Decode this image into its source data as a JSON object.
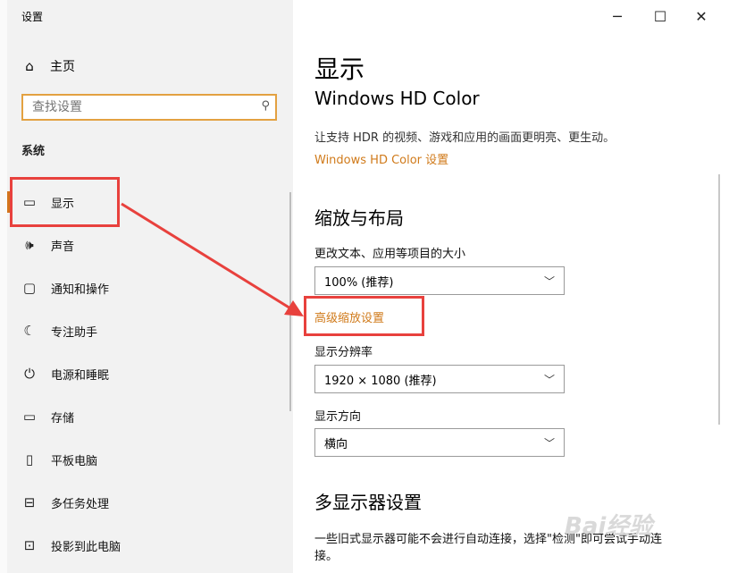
{
  "window": {
    "title": "设置",
    "minimize": "─",
    "maximize": "☐",
    "close": "✕"
  },
  "sidebar": {
    "home": {
      "icon": "⌂",
      "label": "主页"
    },
    "search": {
      "placeholder": "查找设置",
      "icon": "⚲"
    },
    "section": "系统",
    "items": [
      {
        "icon": "▭",
        "label": "显示"
      },
      {
        "icon": "🕪",
        "label": "声音"
      },
      {
        "icon": "▢",
        "label": "通知和操作"
      },
      {
        "icon": "☾",
        "label": "专注助手"
      },
      {
        "icon": "⏻",
        "label": "电源和睡眠"
      },
      {
        "icon": "▭",
        "label": "存储"
      },
      {
        "icon": "▯",
        "label": "平板电脑"
      },
      {
        "icon": "⊟",
        "label": "多任务处理"
      },
      {
        "icon": "⊡",
        "label": "投影到此电脑"
      }
    ]
  },
  "main": {
    "title": "显示",
    "hdr_heading": "Windows HD Color",
    "hdr_desc": "让支持 HDR 的视频、游戏和应用的画面更明亮、更生动。",
    "hdr_link": "Windows HD Color 设置",
    "scale_heading": "缩放与布局",
    "scale_label": "更改文本、应用等项目的大小",
    "scale_value": "100% (推荐)",
    "advanced_link": "高级缩放设置",
    "resolution_label": "显示分辨率",
    "resolution_value": "1920 × 1080 (推荐)",
    "orientation_label": "显示方向",
    "orientation_value": "横向",
    "multi_heading": "多显示器设置",
    "multi_desc_1": "一些旧式显示器可能不会进行自动连接，选择\"检测\"即可尝试手动连",
    "multi_desc_2": "接。",
    "chevron": "﹀"
  },
  "watermark": "Bai经验",
  "colors": {
    "accent": "#d07a1a",
    "highlight": "#e8413d",
    "sidebar_bg": "#f2f2f2"
  }
}
